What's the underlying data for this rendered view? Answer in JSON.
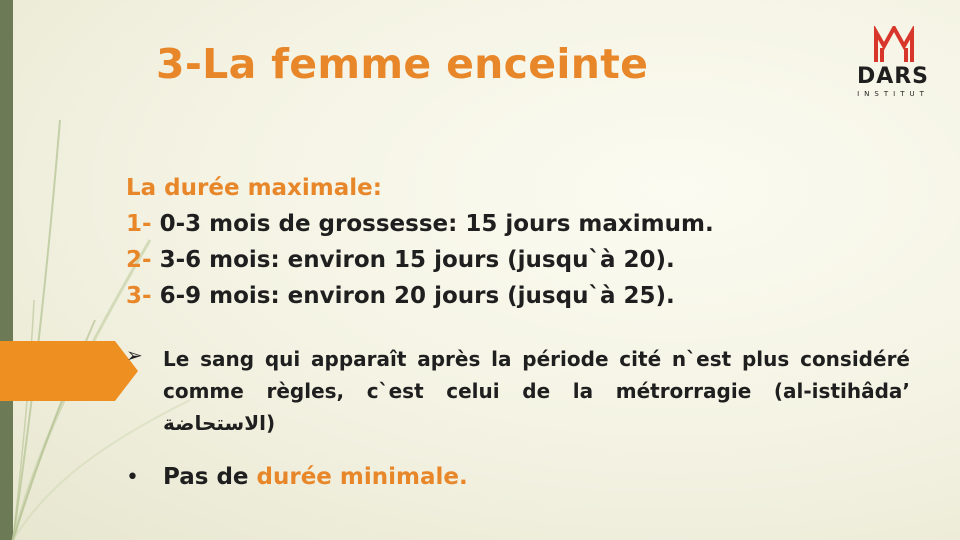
{
  "slide": {
    "title": "3-La femme enceinte"
  },
  "logo": {
    "name": "DARS",
    "subtitle": "INSTITUT"
  },
  "duration": {
    "heading": "La durée maximale:",
    "items": [
      {
        "number": "1-",
        "text": " 0-3 mois de grossesse: 15 jours maximum."
      },
      {
        "number": "2-",
        "text": " 3-6 mois: environ 15 jours (jusqu`à 20)."
      },
      {
        "number": "3-",
        "text": " 6-9 mois: environ 20 jours (jusqu`à 25)."
      }
    ]
  },
  "arrow_bullet": {
    "marker": "➢",
    "text": "Le sang qui apparaît après la période cité n`est plus considéré comme règles, c`est celui de la métrorragie (al-istihâda’ الاستحاضة)"
  },
  "bullet": {
    "marker": "•",
    "prefix": "Pas de ",
    "highlight": "durée minimale."
  },
  "colors": {
    "accent": "#e8872a",
    "text": "#1f1f1f",
    "sidebar": "#6c7a55",
    "tab": "#ee8f22",
    "logo_red": "#d9362b"
  }
}
